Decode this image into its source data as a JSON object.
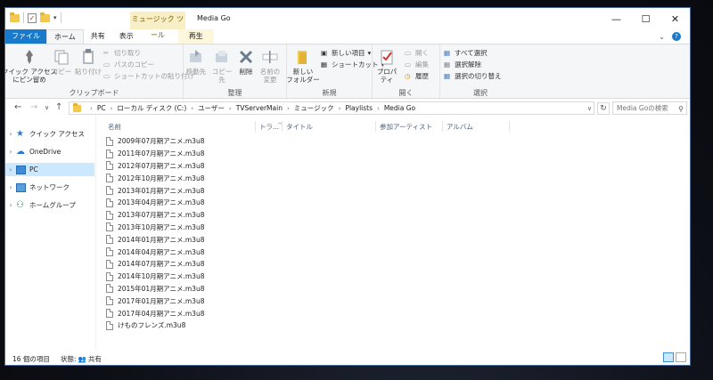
{
  "window": {
    "title": "Media Go",
    "context_tab": "ミュージック ツール",
    "minimize": "—",
    "maximize": "☐",
    "close": "✕"
  },
  "ribbon_tabs": {
    "file": "ファイル",
    "home": "ホーム",
    "share": "共有",
    "view": "表示",
    "play": "再生"
  },
  "ribbon": {
    "clipboard": {
      "pin": "クイック アクセス\nにピン留め",
      "copy": "コピー",
      "paste": "貼り付け",
      "cut": "切り取り",
      "copy_path": "パスのコピー",
      "paste_shortcut": "ショートカットの貼り付け",
      "label": "クリップボード"
    },
    "organize": {
      "move_to": "移動先",
      "copy_to": "コピー先",
      "delete": "削除",
      "rename": "名前の\n変更",
      "label": "整理"
    },
    "new": {
      "new_folder": "新しい\nフォルダー",
      "new_item": "新しい項目",
      "shortcut": "ショートカット",
      "label": "新規"
    },
    "open": {
      "properties": "プロパティ",
      "open": "開く",
      "edit": "編集",
      "history": "履歴",
      "label": "開く"
    },
    "select": {
      "select_all": "すべて選択",
      "select_none": "選択解除",
      "invert": "選択の切り替え",
      "label": "選択"
    }
  },
  "address": {
    "crumbs": [
      "PC",
      "ローカル ディスク (C:)",
      "ユーザー",
      "TVServerMain",
      "ミュージック",
      "Playlists",
      "Media Go"
    ],
    "search_placeholder": "Media Goの検索"
  },
  "nav": {
    "items": [
      {
        "label": "クイック アクセス",
        "icon": "star-icon"
      },
      {
        "label": "OneDrive",
        "icon": "cloud-icon"
      },
      {
        "label": "PC",
        "icon": "monitor-icon"
      },
      {
        "label": "ネットワーク",
        "icon": "network-icon"
      },
      {
        "label": "ホームグループ",
        "icon": "homegroup-icon"
      }
    ]
  },
  "columns": {
    "name": "名前",
    "track": "トラ...",
    "title": "タイトル",
    "artist": "参加アーティスト",
    "album": "アルバム"
  },
  "files": [
    "2009年07月期アニメ.m3u8",
    "2011年07月期アニメ.m3u8",
    "2012年07月期アニメ.m3u8",
    "2012年10月期アニメ.m3u8",
    "2013年01月期アニメ.m3u8",
    "2013年04月期アニメ.m3u8",
    "2013年07月期アニメ.m3u8",
    "2013年10月期アニメ.m3u8",
    "2014年01月期アニメ.m3u8",
    "2014年04月期アニメ.m3u8",
    "2014年07月期アニメ.m3u8",
    "2014年10月期アニメ.m3u8",
    "2015年01月期アニメ.m3u8",
    "2017年01月期アニメ.m3u8",
    "2017年04月期アニメ.m3u8",
    "けものフレンズ.m3u8"
  ],
  "status": {
    "count": "16 個の項目",
    "state_label": "状態:",
    "state_value": "共有"
  },
  "colors": {
    "file_tab": "#1979ca",
    "selection": "#cce8ff",
    "context_tab": "#f9efc6"
  }
}
